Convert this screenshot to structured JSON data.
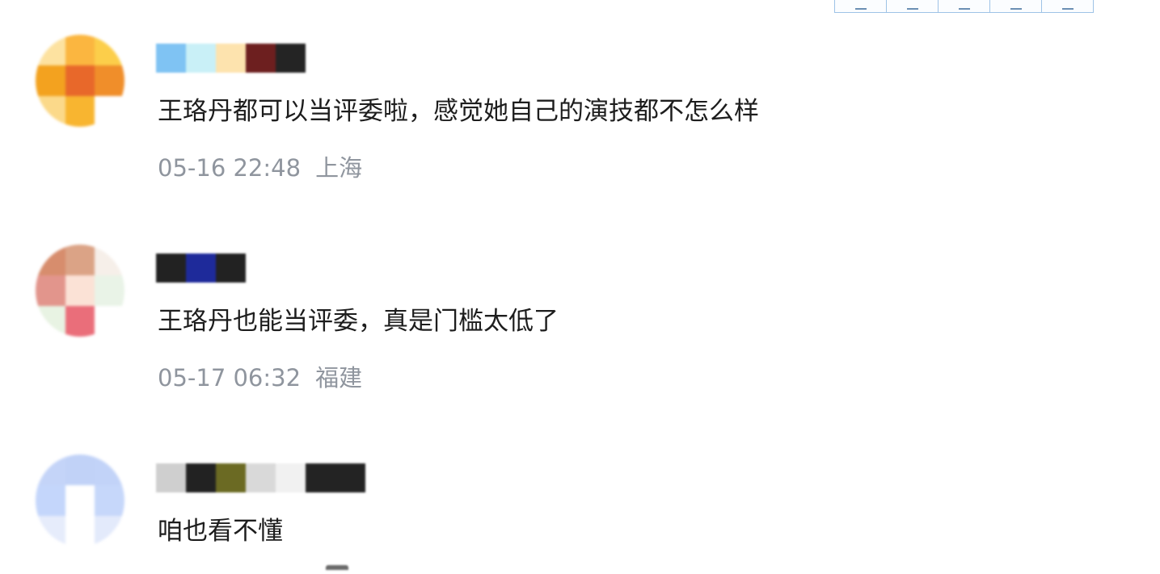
{
  "toolbar": {
    "buttons": [
      "toolbar-button-1",
      "toolbar-button-2",
      "toolbar-button-3",
      "toolbar-button-4",
      "toolbar-button-5"
    ]
  },
  "comments": [
    {
      "avatar_colors": [
        "#fde2a0",
        "#fbb640",
        "#fcce4a",
        "#f3a21f",
        "#e8682a",
        "#f08e2a",
        "#fbd98a",
        "#f8b530",
        "#ffffff"
      ],
      "nickname_colors": [
        "#7fc3f3",
        "#c9f0f7",
        "#fde3ae",
        "#6d1f1f",
        "#242424"
      ],
      "text": "王珞丹都可以当评委啦，感觉她自己的演技都不怎么样",
      "time": "05-16 22:48",
      "location": "上海"
    },
    {
      "avatar_colors": [
        "#d78d6d",
        "#dba386",
        "#f6efe9",
        "#e2958c",
        "#fbe2d6",
        "#e9f3e7",
        "#e8f3e3",
        "#ea6e7a",
        "#ffffff"
      ],
      "nickname_colors": [
        "#222222",
        "#1e2a9a",
        "#222222"
      ],
      "text": "王珞丹也能当评委，真是门槛太低了",
      "time": "05-17 06:32",
      "location": "福建"
    },
    {
      "avatar_colors": [
        "#c4d4f8",
        "#c1d2f7",
        "#c2d3f8",
        "#c4d6fb",
        "#ffffff",
        "#c6d7fa",
        "#e6ecfb",
        "#ffffff",
        "#e3eafb"
      ],
      "nickname_colors": [
        "#cfcfcf",
        "#222222",
        "#6b6a23",
        "#d9d9d9",
        "#f1f1f1",
        "#232323",
        "#232323"
      ],
      "text": "咱也看不懂",
      "time": "",
      "location": ""
    }
  ]
}
